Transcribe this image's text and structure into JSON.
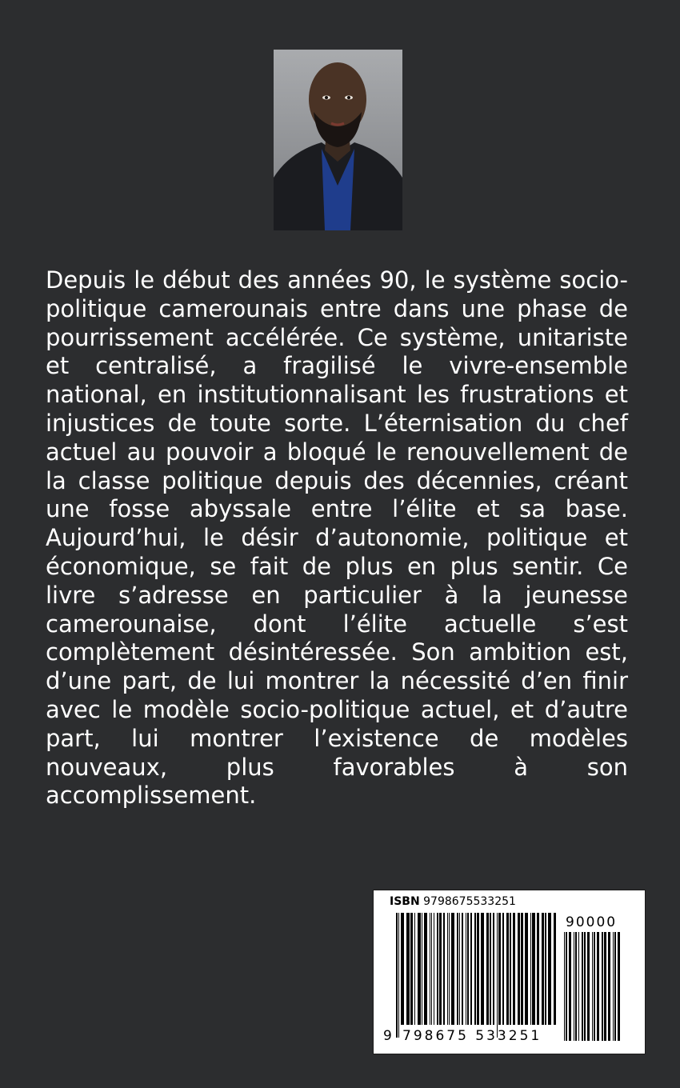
{
  "cover": {
    "background": "#2c2d2f",
    "author_photo": "author-portrait-photo",
    "blurb": "Depuis le début des années 90, le système socio-politique camerounais entre dans une phase de pourrissement accélérée. Ce système, unitariste et centralisé, a fragilisé le vivre-ensemble national, en institutionnalisant les frustrations et injustices de toute sorte. L’éternisation du chef actuel au pouvoir a bloqué le renouvellement de la classe politique depuis des décennies, créant une fosse abyssale entre l’élite et sa base. Aujourd’hui, le désir d’autonomie, politique et économique, se fait de plus en plus sentir. Ce livre s’adresse en particulier à la jeunesse camerounaise, dont l’élite actuelle s’est complètement désintéressée. Son ambition est, d’une part, de lui montrer la nécessité d’en finir avec le modèle socio-politique actuel, et d’autre part, lui montrer l’existence de modèles nouveaux, plus favorables à son accomplissement."
  },
  "barcode": {
    "isbn_label": "ISBN",
    "isbn_number": "9798675533251",
    "digit_first": "9",
    "digits_rest": "798675 533251",
    "addon": "90000"
  }
}
